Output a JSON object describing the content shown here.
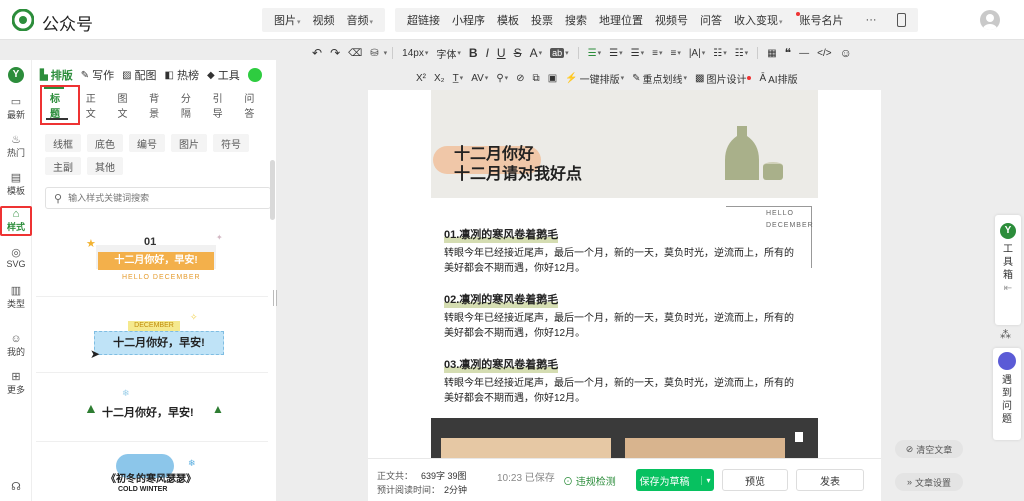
{
  "app": {
    "title": "公众号"
  },
  "menus": {
    "group1": [
      {
        "label": "图片",
        "caret": true
      },
      {
        "label": "视频",
        "caret": false
      },
      {
        "label": "音频",
        "caret": true
      }
    ],
    "group2": [
      {
        "label": "超链接"
      },
      {
        "label": "小程序"
      },
      {
        "label": "模板"
      },
      {
        "label": "投票"
      },
      {
        "label": "搜索"
      },
      {
        "label": "地理位置"
      },
      {
        "label": "视频号"
      },
      {
        "label": "问答"
      },
      {
        "label": "收入变现",
        "caret": true
      },
      {
        "label": "账号名片",
        "dot": true
      }
    ],
    "more": "···"
  },
  "toolbar": {
    "undo": "↶",
    "redo": "↷",
    "eraser": "⌫",
    "paint": "⛁",
    "fontsize": "14px",
    "font": "字体",
    "bold": "B",
    "italic": "I",
    "underline": "U",
    "strike": "S",
    "fontcolor": "A",
    "bgcolor": "ab",
    "quote": "❝",
    "divider": "—",
    "code": "</>",
    "emoji": "☺",
    "superscript": "X²",
    "subscript": "X₂",
    "one_click": "一键排版",
    "highlight": "重点划线",
    "image_design": "图片设计",
    "ai_layout": "AI排版"
  },
  "leftstrip": {
    "items": [
      {
        "label": "最新"
      },
      {
        "label": "热门"
      },
      {
        "label": "模板"
      },
      {
        "label": "样式"
      },
      {
        "label": "SVG"
      },
      {
        "label": "类型"
      },
      {
        "label": "我的"
      },
      {
        "label": "更多"
      }
    ]
  },
  "panel": {
    "tabs": [
      {
        "label": "排版"
      },
      {
        "label": "写作"
      },
      {
        "label": "配图"
      },
      {
        "label": "热榜"
      },
      {
        "label": "工具"
      }
    ],
    "subtabs": [
      "标题",
      "正文",
      "图文",
      "背景",
      "分隔",
      "引导",
      "问答"
    ],
    "chips": [
      "线框",
      "底色",
      "编号",
      "图片",
      "符号",
      "主副",
      "其他"
    ],
    "search_placeholder": "输入样式关键词搜索",
    "cards": [
      {
        "num": "01",
        "title": "十二月你好，早安!",
        "sub": "HELLO DECEMBER"
      },
      {
        "label": "DECEMBER",
        "title": "十二月你好，早安!"
      },
      {
        "title": "十二月你好，早安!"
      },
      {
        "title": "《初冬的寒风瑟瑟》",
        "sub": "COLD WINTER"
      }
    ]
  },
  "document": {
    "hero_line1": "十二月你好",
    "hero_line2": "十二月请对我好点",
    "side_label1": "HELLO",
    "side_label2": "DECEMBER",
    "sections": [
      {
        "heading": "01.凛冽的寒风卷着鹅毛",
        "body": "转眼今年已经接近尾声，最后一个月，新的一天，莫负时光，逆流而上，所有的美好都会不期而遇，你好12月。"
      },
      {
        "heading": "02.凛冽的寒风卷着鹅毛",
        "body": "转眼今年已经接近尾声，最后一个月，新的一天，莫负时光，逆流而上，所有的美好都会不期而遇，你好12月。"
      },
      {
        "heading": "03.凛冽的寒风卷着鹅毛",
        "body": "转眼今年已经接近尾声，最后一个月，新的一天，莫负时光，逆流而上，所有的美好都会不期而遇，你好12月。"
      }
    ]
  },
  "bottom": {
    "wordcount_label": "正文共：",
    "wordcount": "639字 39图",
    "readtime_label": "预计阅读时间：",
    "readtime": "2分钟",
    "saved": "10:23 已保存",
    "check": "违规检测",
    "save_draft": "保存为草稿",
    "preview": "预览",
    "publish": "发表"
  },
  "right": {
    "toolbox": "工具箱",
    "help": "遇到问题",
    "clear": "清空文章",
    "settings": "文章设置"
  },
  "colors": {
    "brand": "#2c8d3b",
    "accent_green": "#07c160",
    "red_highlight": "#e33333"
  }
}
